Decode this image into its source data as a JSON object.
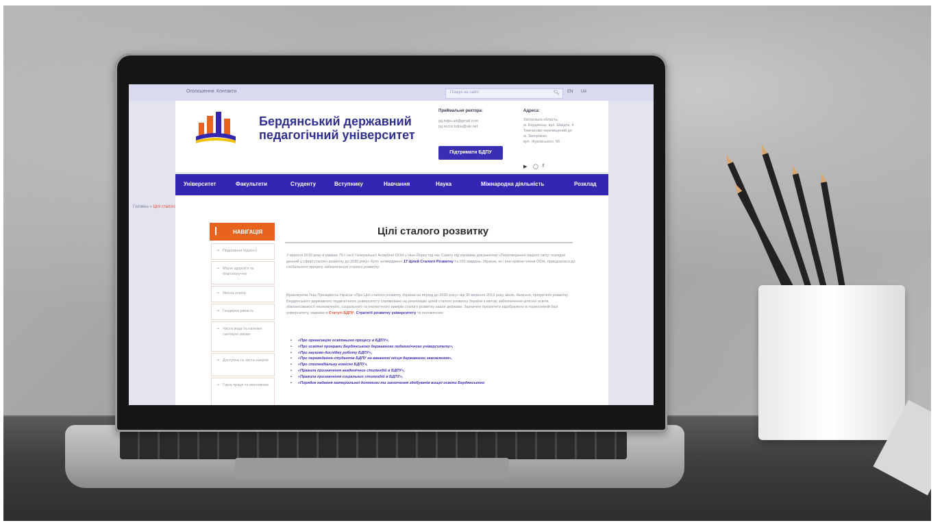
{
  "topbar": {
    "links": [
      "Оголошення",
      "Контакти"
    ],
    "search_placeholder": "Пошук на сайті",
    "languages": [
      "EN",
      "UA"
    ]
  },
  "header": {
    "university_name_line1": "Бердянський державний",
    "university_name_line2": "педагогічний університет",
    "rector_label": "Приймальня ректора:",
    "rector_emails": [
      "pg.bdpu.ad@gmail.com",
      "pg.rector.bdpu@ukr.net"
    ],
    "support_button": "Підтримати БДПУ",
    "address_label": "Адреса:",
    "address_lines": [
      "Запорізька область,",
      "м. Бердянськ, вул. Шмідта, 4",
      "Тимчасово переміщений до",
      "м. Запоріжжя,",
      "вул. Жуковського, 66"
    ]
  },
  "nav": {
    "items": [
      "Університет",
      "Факультети",
      "Студенту",
      "Вступнику",
      "Навчання",
      "Наука",
      "Міжнародна діяльність",
      "Розклад"
    ]
  },
  "breadcrumb": {
    "home": "Головна",
    "separator": "»",
    "current": "Цілі сталого розвитку"
  },
  "sidenav": {
    "title": "НАВІГАЦІЯ",
    "items": [
      "Подолання бідності",
      "Міцне здоров'я та благополуччя",
      "Якісна освіта",
      "Гендерна рівність",
      "Чиста вода та належні санітарні умови",
      "Доступна та чиста енергія",
      "Гідна праця та економічне"
    ]
  },
  "main": {
    "title": "Цілі сталого розвитку",
    "para1": "У вересні 2015 року в рамках 70-ї сесії Генеральної Асамблеї ООН у Нью-Йорку під час Саміту під умовами документом «Перетворення нашого світу: порядок денний у сфері сталого розвитку до 2030 року» було затверджено",
    "para1_link": "17 Цілей Сталого Розвитку",
    "para1_end": "та 169 завдань. Україна, як і інші країни-члени ООН, приєдналася до глобального процесу забезпечення сталого розвитку.",
    "para2": "Враховуючи Указ Президента України «Про Цілі сталого розвитку України на період до 2030 року» від 30 вересня 2019 року, місію, бачення, пріоритети розвитку Бердянського державного педагогічного університету спрямовано на реалізацію цілей сталого розвитку України з метою забезпечення цілісної освіти, збалансованості економічного, соціального та екологічного вимірів сталого розвитку нашої держави. Зазначені пріоритети відображено в нормативній базі університету, зокрема в",
    "para2_link_statute": "Статуті БДПУ",
    "para2_link_strategy": "Стратегії розвитку університету",
    "para2_end": "та положеннях:",
    "documents": [
      "«Про організацію освітнього процесу в БДПУ»,",
      "«Про освітні програми Бердянського державного педагогічного університету»,",
      "«Про науково-дослідну роботу БДПУ»,",
      "«Про переведення студентів БДПУ на вакантні місця державного замовлення»,",
      "«Про стипендіальну комісію БДПУ»,",
      "«Правила призначення академічних стипендій в БДПУ»,",
      "«Правила призначення соціальних стипендій в БДПУ»,",
      "«Порядок надання матеріальної допомоги та заохочення здобувачів вищої освіти Бердянського"
    ]
  },
  "colors": {
    "nav": "#3426b0",
    "accent_orange": "#e8631e",
    "link_blue": "#3a2fb4",
    "link_red": "#e04a2f"
  }
}
